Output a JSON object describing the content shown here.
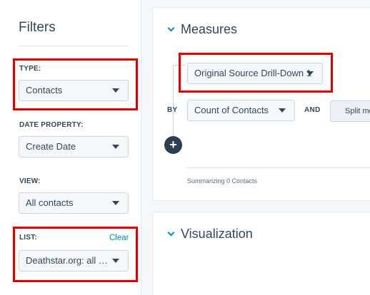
{
  "filters": {
    "title": "Filters",
    "type": {
      "label": "TYPE:",
      "value": "Contacts"
    },
    "date_property": {
      "label": "DATE PROPERTY:",
      "value": "Create Date"
    },
    "view": {
      "label": "VIEW:",
      "value": "All contacts"
    },
    "list": {
      "label": "LIST:",
      "clear": "Clear",
      "value": "Deathstar.org: all c..."
    }
  },
  "measures": {
    "title": "Measures",
    "primary_dimension": "Original Source Drill-Down 1",
    "by_label": "BY",
    "metric": "Count of Contacts",
    "and_label": "AND",
    "split_label": "Split me",
    "add_symbol": "+",
    "summary": "Summarizing 0 Contacts"
  },
  "visualization": {
    "title": "Visualization"
  },
  "colors": {
    "highlight": "#e00000",
    "link": "#0091ae",
    "text": "#33475b",
    "add_button": "#2d3e50"
  }
}
